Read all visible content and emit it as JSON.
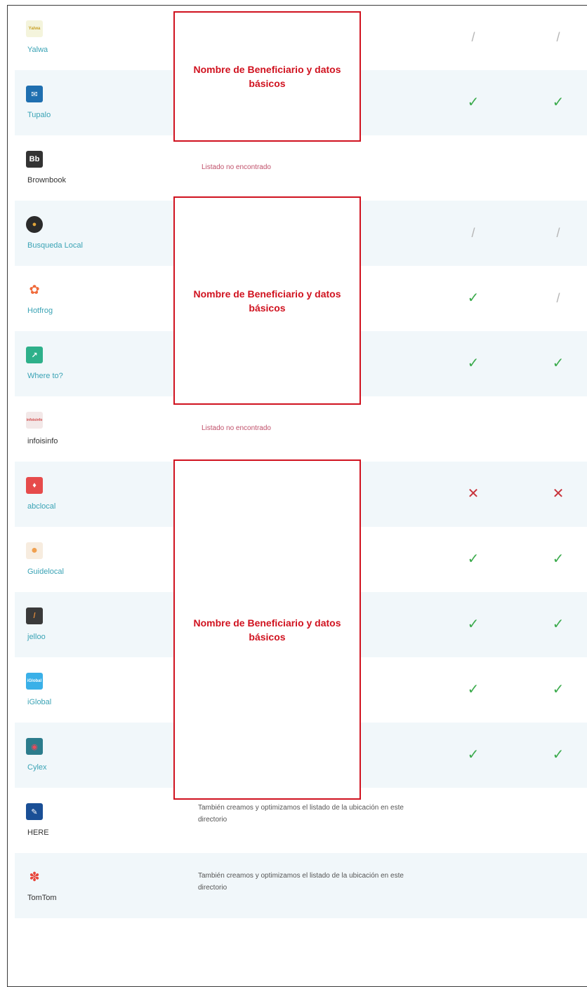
{
  "rows": [
    {
      "name": "Yalwa",
      "logo": "Yalwa",
      "logo_color": "#f4f4dc",
      "col1": "slash",
      "col2": "slash",
      "col1_glyph": "/",
      "col2_glyph": "/"
    },
    {
      "name": "Tupalo",
      "logo": "✉",
      "logo_color": "#1f6fb0",
      "col1": "check",
      "col2": "check",
      "col1_glyph": "✓",
      "col2_glyph": "✓"
    },
    {
      "name": "Brownbook",
      "logo": "Bb",
      "logo_color": "#333333",
      "note": "Listado no encontrado"
    },
    {
      "name": "Busqueda Local",
      "logo": "●",
      "logo_color": "#e0a43a",
      "col1": "slash",
      "col2": "slash",
      "col1_glyph": "/",
      "col2_glyph": "/"
    },
    {
      "name": "Hotfrog",
      "logo": "✿",
      "logo_color": "#f06a3a",
      "col1": "check",
      "col2": "slash",
      "col1_glyph": "✓",
      "col2_glyph": "/"
    },
    {
      "name": "Where to?",
      "logo": "↗",
      "logo_color": "#2eb08a",
      "col1": "check",
      "col2": "check",
      "col1_glyph": "✓",
      "col2_glyph": "✓"
    },
    {
      "name": "infoisinfo",
      "logo": "infoisinfo",
      "logo_color": "#f3e8e8",
      "note": "Listado no encontrado"
    },
    {
      "name": "abclocal",
      "logo": "♦",
      "logo_color": "#e64b4b",
      "col1": "cross",
      "col2": "cross",
      "col1_glyph": "✕",
      "col2_glyph": "✕"
    },
    {
      "name": "Guidelocal",
      "logo": "●",
      "logo_color": "#f0a050",
      "col1": "check",
      "col2": "check",
      "col1_glyph": "✓",
      "col2_glyph": "✓"
    },
    {
      "name": "jelloo",
      "logo": "/",
      "logo_color": "#3a3a3a",
      "col1": "check",
      "col2": "check",
      "col1_glyph": "✓",
      "col2_glyph": "✓"
    },
    {
      "name": "iGlobal",
      "logo": "iGlobal",
      "logo_color": "#3ab0e8",
      "col1": "check",
      "col2": "check",
      "col1_glyph": "✓",
      "col2_glyph": "✓"
    },
    {
      "name": "Cylex",
      "logo": "◉",
      "logo_color": "#2c7c8c",
      "col1": "check",
      "col2": "check",
      "col1_glyph": "✓",
      "col2_glyph": "✓"
    },
    {
      "name": "HERE",
      "logo": "✎",
      "logo_color": "#1a4f96",
      "info": "También creamos y optimizamos el listado de la ubicación en este directorio"
    },
    {
      "name": "TomTom",
      "logo": "✽",
      "logo_color": "#e8453a",
      "info": "También creamos y optimizamos el listado de la ubicación en este directorio"
    }
  ],
  "redaction_label": "Nombre de Beneficiario y datos básicos",
  "colors": {
    "accent_red": "#d0121f",
    "check_green": "#3cab4d",
    "cross_red": "#c8323a",
    "row_alt_bg": "#f1f7fa",
    "name_teal": "#3aa3b5"
  }
}
